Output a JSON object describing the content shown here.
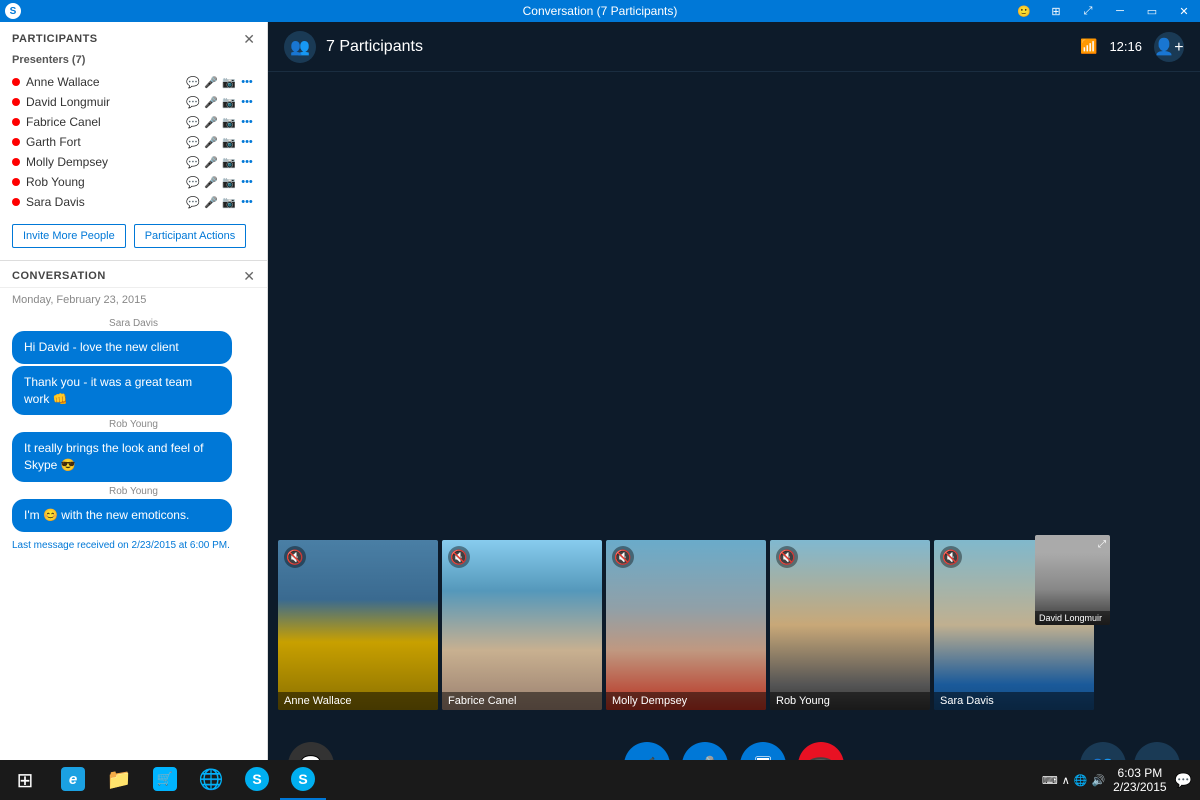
{
  "titlebar": {
    "title": "Conversation (7 Participants)",
    "controls": [
      "emoji",
      "grid",
      "expand",
      "minimize",
      "restore",
      "close"
    ]
  },
  "participants": {
    "section_title": "PARTICIPANTS",
    "presenters_label": "Presenters (7)",
    "list": [
      {
        "name": "Anne Wallace",
        "dot": "red",
        "icons": [
          "chat",
          "mic-muted",
          "camera",
          "more"
        ]
      },
      {
        "name": "David Longmuir",
        "dot": "red",
        "icons": [
          "chat",
          "mic",
          "camera",
          "more"
        ]
      },
      {
        "name": "Fabrice Canel",
        "dot": "red",
        "icons": [
          "chat-off",
          "mic-muted",
          "camera",
          "more"
        ]
      },
      {
        "name": "Garth Fort",
        "dot": "red",
        "icons": [
          "chat",
          "mic-muted",
          "camera",
          "more"
        ]
      },
      {
        "name": "Molly Dempsey",
        "dot": "red",
        "icons": [
          "chat",
          "mic",
          "camera",
          "more"
        ]
      },
      {
        "name": "Rob Young",
        "dot": "red",
        "icons": [
          "chat",
          "mic-muted",
          "camera",
          "more"
        ]
      },
      {
        "name": "Sara Davis",
        "dot": "red",
        "icons": [
          "chat",
          "mic-muted",
          "camera",
          "more"
        ]
      }
    ],
    "invite_btn": "Invite More People",
    "actions_btn": "Participant Actions"
  },
  "conversation": {
    "section_title": "CONVERSATION",
    "date": "Monday, February 23, 2015",
    "messages": [
      {
        "sender": "Sara Davis",
        "text": "Hi David - love the new client",
        "style": "blue"
      },
      {
        "sender": "",
        "text": "Thank you - it was a great team work 👊",
        "style": "blue"
      },
      {
        "sender": "Rob Young",
        "text": "It really brings the look and feel of Skype 😎",
        "style": "blue"
      },
      {
        "sender": "Rob Young",
        "text": "I'm 😊 with the new emoticons.",
        "style": "blue"
      }
    ],
    "last_message": "Last message received on 2/23/2015 at 6:00 PM.",
    "toolbar_icons": [
      "attachment",
      "urgent",
      "emoji",
      "send"
    ]
  },
  "video_area": {
    "participants_count": "7 Participants",
    "time": "12:16",
    "participants": [
      {
        "name": "Anne Wallace",
        "muted": true,
        "color_class": "anne"
      },
      {
        "name": "Fabrice Canel",
        "muted": true,
        "color_class": "fabrice"
      },
      {
        "name": "Molly Dempsey",
        "muted": true,
        "color_class": "molly"
      },
      {
        "name": "Rob Young",
        "muted": true,
        "color_class": "rob"
      },
      {
        "name": "Sara Davis",
        "muted": true,
        "color_class": "sara"
      },
      {
        "name": "David Longmuir",
        "muted": false,
        "color_class": "david",
        "small": true
      }
    ]
  },
  "controls": {
    "chat": "💬",
    "video": "📹",
    "mic": "🎤",
    "screen": "🖥",
    "end": "📞",
    "participants": "👥",
    "more": "•••"
  },
  "taskbar": {
    "time": "6:03 PM",
    "date": "2/23/2015",
    "apps": [
      {
        "name": "windows",
        "icon": "⊞",
        "color": "#0078d7"
      },
      {
        "name": "ie",
        "icon": "e",
        "color": "#1ba1e2"
      },
      {
        "name": "folder",
        "icon": "📁",
        "color": "#f0c030"
      },
      {
        "name": "store",
        "icon": "🛒",
        "color": "#00b4ff"
      },
      {
        "name": "chrome",
        "icon": "◉",
        "color": "#4285f4"
      },
      {
        "name": "skype-app",
        "icon": "S",
        "color": "#00aff0"
      },
      {
        "name": "skype-active",
        "icon": "S",
        "color": "#00aff0",
        "active": true
      }
    ]
  }
}
